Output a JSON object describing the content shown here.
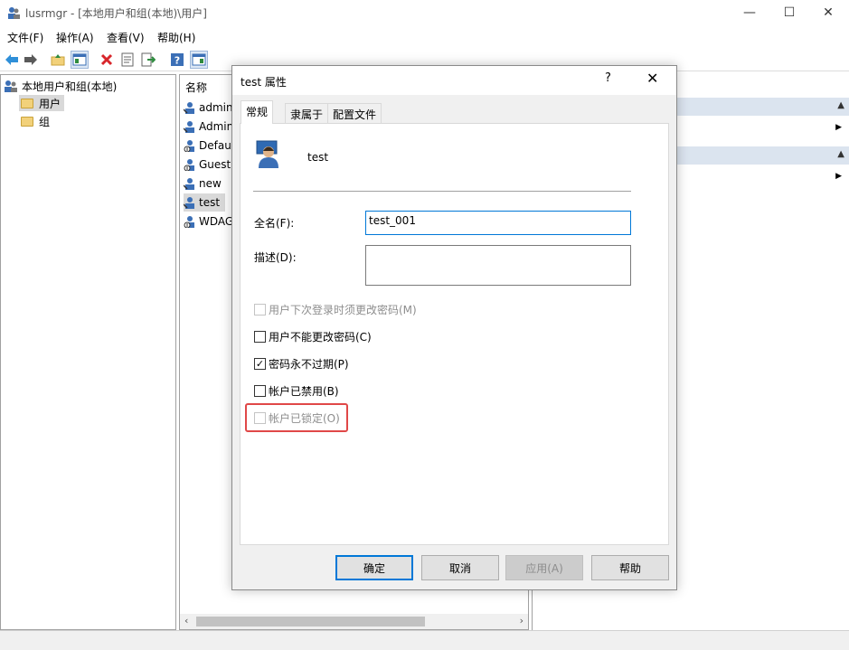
{
  "window": {
    "title": "lusrmgr - [本地用户和组(本地)\\用户]",
    "minimize": "—",
    "maximize": "☐",
    "close": "✕"
  },
  "menu": [
    "文件(F)",
    "操作(A)",
    "查看(V)",
    "帮助(H)"
  ],
  "tree": {
    "root": "本地用户和组(本地)",
    "items": [
      "用户",
      "组"
    ]
  },
  "list": {
    "column": "名称",
    "users": [
      "admin",
      "Admin",
      "Defau",
      "Guest",
      "new",
      "test",
      "WDAG"
    ]
  },
  "dialog": {
    "title": "test 属性",
    "help": "?",
    "close": "✕",
    "tabs": [
      "常规",
      "隶属于",
      "配置文件"
    ],
    "username": "test",
    "fullname_label": "全名(F):",
    "fullname_value": "test_001",
    "desc_label": "描述(D):",
    "desc_value": "",
    "checkboxes": [
      {
        "label": "用户下次登录时须更改密码(M)",
        "checked": false,
        "disabled": true
      },
      {
        "label": "用户不能更改密码(C)",
        "checked": false,
        "disabled": false
      },
      {
        "label": "密码永不过期(P)",
        "checked": true,
        "disabled": false
      },
      {
        "label": "帐户已禁用(B)",
        "checked": false,
        "disabled": false
      },
      {
        "label": "帐户已锁定(O)",
        "checked": false,
        "disabled": true
      }
    ],
    "buttons": {
      "ok": "确定",
      "cancel": "取消",
      "apply": "应用(A)",
      "help": "帮助"
    }
  },
  "colors": {
    "accent": "#0078d7",
    "highlight": "#e04848",
    "selection": "#d9d9d9"
  }
}
